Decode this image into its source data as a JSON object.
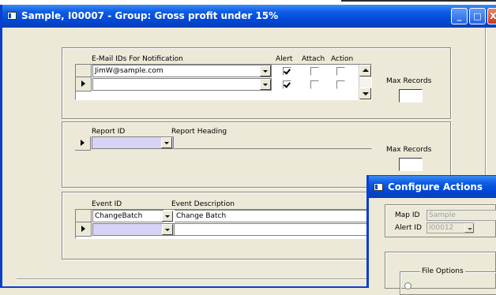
{
  "window": {
    "title": "Sample, I00007  -  Group: Gross profit under 15%",
    "minimize": "_",
    "maximize": "□",
    "close": "X"
  },
  "email_section": {
    "header_email": "E-Mail IDs For Notification",
    "header_alert": "Alert",
    "header_attach": "Attach",
    "header_action": "Action",
    "rows": [
      {
        "email": "JimW@sample.com",
        "alert": true,
        "attach": false,
        "action": false
      },
      {
        "email": "",
        "alert": true,
        "attach": false,
        "action": false
      }
    ],
    "max_records_label": "Max Records",
    "max_records_value": ""
  },
  "report_section": {
    "header_id": "Report ID",
    "header_heading": "Report Heading",
    "rows": [
      {
        "report_id": "",
        "heading": ""
      }
    ],
    "max_records_label": "Max Records",
    "max_records_value": ""
  },
  "event_section": {
    "header_id": "Event ID",
    "header_desc": "Event Description",
    "rows": [
      {
        "event_id": "ChangeBatch",
        "description": "Change Batch"
      },
      {
        "event_id": "",
        "description": ""
      }
    ]
  },
  "configure_dialog": {
    "title": "Configure Actions",
    "map_id_label": "Map ID",
    "map_id_value": "Sample",
    "alert_id_label": "Alert ID",
    "alert_id_value": "I00012",
    "file_options_label": "File Options"
  },
  "colors": {
    "titlebar_blue": "#0046d5",
    "window_bg": "#ece9d8",
    "new_row_highlight": "#d6d3f6"
  }
}
